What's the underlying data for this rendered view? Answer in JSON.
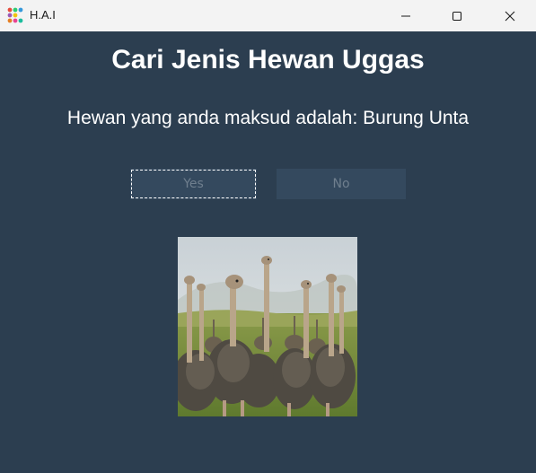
{
  "window": {
    "title": "H.A.I",
    "icon": "app-icon"
  },
  "main": {
    "heading": "Cari Jenis Hewan Uggas",
    "result": "Hewan yang anda maksud adalah: Burung Unta",
    "yes_label": "Yes",
    "no_label": "No",
    "image_subject": "ostriches"
  },
  "colors": {
    "background": "#2c3e50",
    "button": "#34495e",
    "button_text": "#6f7f8e",
    "titlebar": "#f3f3f3"
  }
}
